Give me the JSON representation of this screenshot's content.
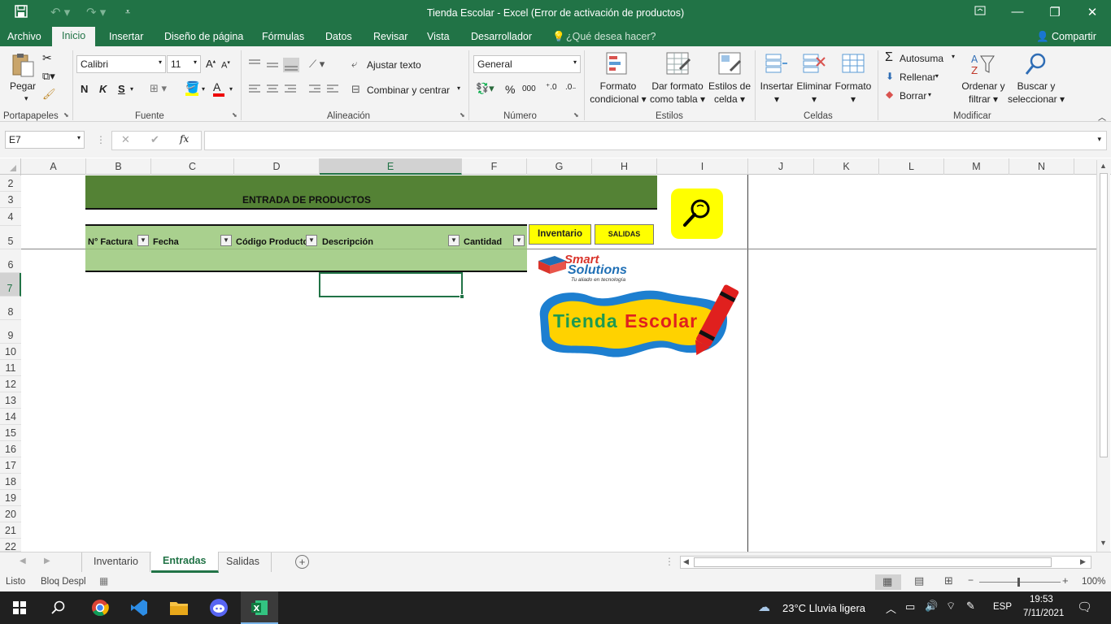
{
  "window": {
    "title": "Tienda Escolar - Excel (Error de activación de productos)"
  },
  "tabs": [
    "Archivo",
    "Inicio",
    "Insertar",
    "Diseño de página",
    "Fórmulas",
    "Datos",
    "Revisar",
    "Vista",
    "Desarrollador"
  ],
  "tell_me": "¿Qué desea hacer?",
  "share": "Compartir",
  "ribbon": {
    "clipboard": {
      "paste": "Pegar",
      "group": "Portapapeles"
    },
    "font": {
      "name": "Calibri",
      "size": "11",
      "bold": "N",
      "italic": "K",
      "underline": "S",
      "group": "Fuente"
    },
    "alignment": {
      "wrap": "Ajustar texto",
      "merge": "Combinar y centrar",
      "group": "Alineación"
    },
    "number": {
      "format": "General",
      "percent": "%",
      "thousands": "000",
      "group": "Número"
    },
    "styles": {
      "conditional1": "Formato",
      "conditional2": "condicional",
      "table1": "Dar formato",
      "table2": "como tabla",
      "cell1": "Estilos de",
      "cell2": "celda",
      "group": "Estilos"
    },
    "cells": {
      "insert": "Insertar",
      "delete": "Eliminar",
      "format": "Formato",
      "group": "Celdas"
    },
    "editing": {
      "autosum": "Autosuma",
      "fill": "Rellenar",
      "clear": "Borrar",
      "sort1": "Ordenar y",
      "sort2": "filtrar",
      "find1": "Buscar y",
      "find2": "seleccionar",
      "group": "Modificar"
    }
  },
  "formula_bar": {
    "name_box": "E7",
    "fx": "fx",
    "value": ""
  },
  "columns": [
    "A",
    "B",
    "C",
    "D",
    "E",
    "F",
    "G",
    "H",
    "I",
    "J",
    "K",
    "L",
    "M",
    "N"
  ],
  "rows": [
    "2",
    "3",
    "4",
    "5",
    "6",
    "7",
    "8",
    "9",
    "10",
    "11",
    "12",
    "13",
    "14",
    "15",
    "16",
    "17",
    "18",
    "19",
    "20",
    "21",
    "22"
  ],
  "sheet": {
    "title": "ENTRADA DE PRODUCTOS",
    "headers": [
      "N° Factura",
      "Fecha",
      "Código Producto",
      "Descripción",
      "Cantidad"
    ],
    "btn_inventario": "Inventario",
    "btn_salidas": "SALIDAS",
    "logo": {
      "line1": "Smart",
      "line2": "Solutions",
      "tagline": "Tu aliado en tecnología"
    },
    "brand": {
      "word1": "Tienda",
      "word2": "Escolar"
    }
  },
  "sheet_tabs": [
    "Inventario",
    "Entradas",
    "Salidas"
  ],
  "status": {
    "ready": "Listo",
    "scroll_lock": "Bloq Despl",
    "zoom": "100%"
  },
  "taskbar": {
    "weather": "23°C  Lluvia ligera",
    "lang": "ESP",
    "time": "19:53",
    "date": "7/11/2021"
  },
  "colors": {
    "excel_green": "#217346",
    "title_band": "#548235",
    "header_fill": "#a9d08e",
    "button_yellow": "#ffff00"
  }
}
